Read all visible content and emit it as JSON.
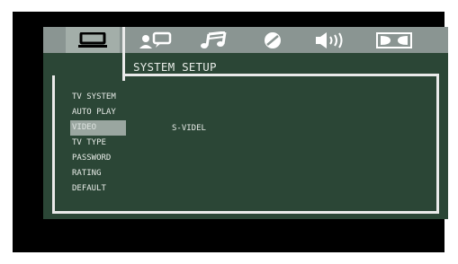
{
  "osd": {
    "colors": {
      "background": "#2b4636",
      "tab_bar": "#8a9592",
      "tab_selected": "#a3aea9",
      "highlight": "#9aa6a0",
      "text": "#e8ece8",
      "frame": "#eaeaea"
    },
    "tabs": [
      {
        "icon": "tv-monitor-icon",
        "selected": true
      },
      {
        "icon": "speaker-person-icon",
        "selected": false
      },
      {
        "icon": "music-note-icon",
        "selected": false
      },
      {
        "icon": "disc-icon",
        "selected": false
      },
      {
        "icon": "volume-sound-icon",
        "selected": false
      },
      {
        "icon": "dolby-digital-icon",
        "selected": false
      }
    ],
    "title": "SYSTEM SETUP",
    "menu": [
      "TV SYSTEM",
      "AUTO PLAY",
      "VIDEO",
      "TV TYPE",
      "PASSWORD",
      "RATING",
      "DEFAULT"
    ],
    "highlighted_item": "VIDEO",
    "selected_value": "S-VIDEL"
  }
}
